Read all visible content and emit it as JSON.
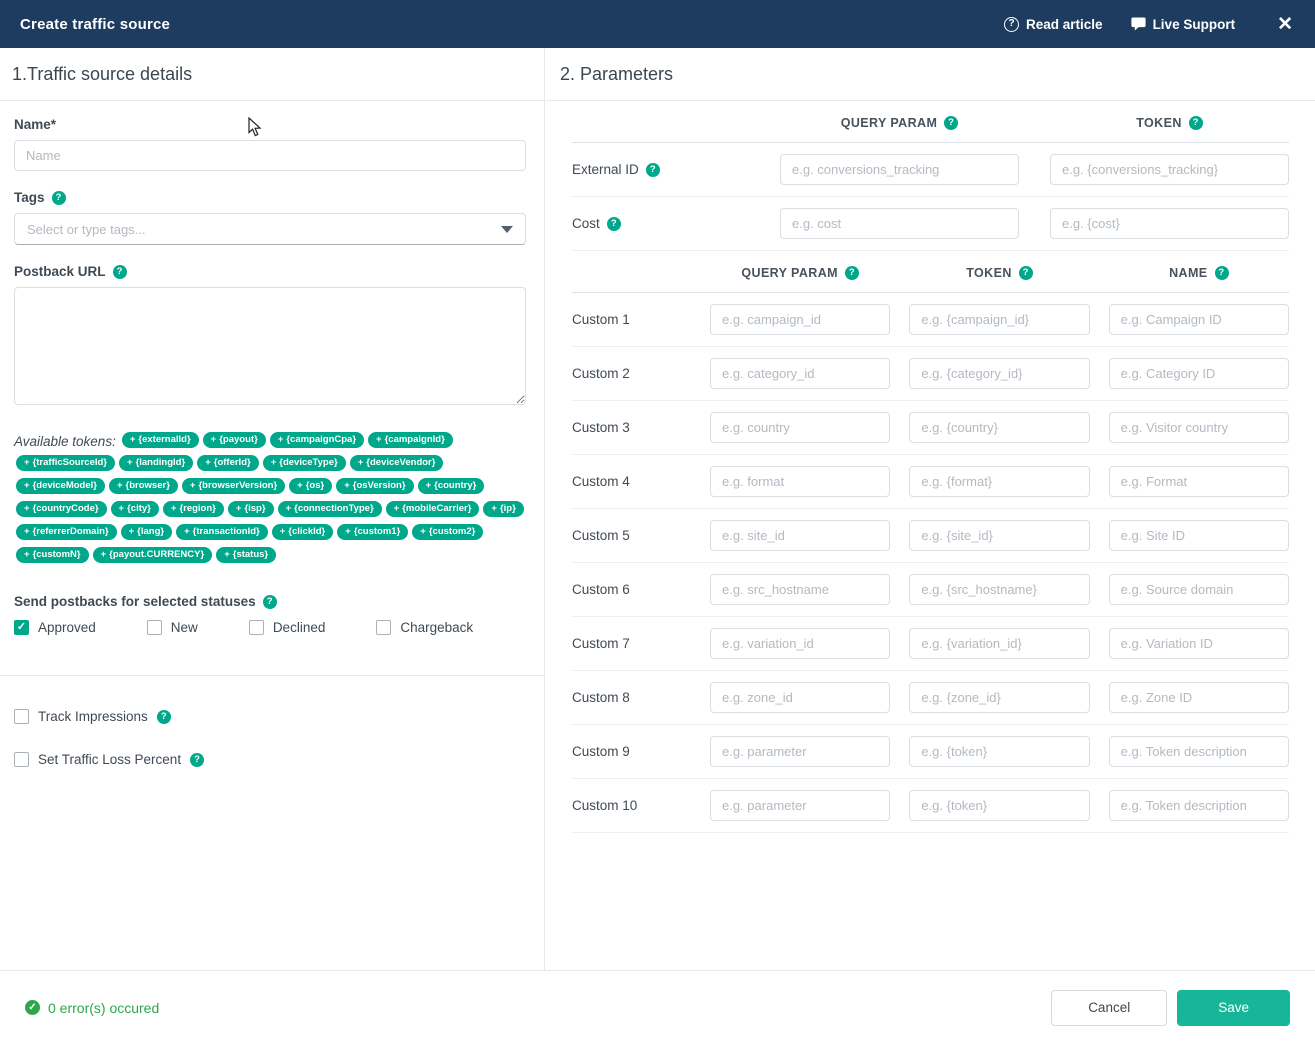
{
  "colors": {
    "header_bg": "#1e3c5f",
    "accent": "#00a88b",
    "save_bg": "#17b69a",
    "success": "#2ba84a",
    "text": "#3f4a54",
    "placeholder": "#b3bac1",
    "border": "#d9dee3"
  },
  "header": {
    "title": "Create traffic source",
    "read_article": "Read article",
    "live_support": "Live Support",
    "close_icon": "✕"
  },
  "left": {
    "section_title": "1.Traffic source details",
    "name_label": "Name*",
    "name_placeholder": "Name",
    "tags_label": "Tags",
    "tags_placeholder": "Select or type tags...",
    "postback_label": "Postback URL",
    "postback_value": "",
    "available_tokens_label": "Available tokens:",
    "tokens": [
      "{externalId}",
      "{payout}",
      "{campaignCpa}",
      "{campaignId}",
      "{trafficSourceId}",
      "{landingId}",
      "{offerId}",
      "{deviceType}",
      "{deviceVendor}",
      "{deviceModel}",
      "{browser}",
      "{browserVersion}",
      "{os}",
      "{osVersion}",
      "{country}",
      "{countryCode}",
      "{city}",
      "{region}",
      "{isp}",
      "{connectionType}",
      "{mobileCarrier}",
      "{ip}",
      "{referrerDomain}",
      "{lang}",
      "{transactionId}",
      "{clickId}",
      "{custom1}",
      "{custom2}",
      "{customN}",
      "{payout.CURRENCY}",
      "{status}"
    ],
    "statuses_label": "Send postbacks for selected statuses",
    "statuses": [
      {
        "label": "Approved",
        "checked": true
      },
      {
        "label": "New",
        "checked": false
      },
      {
        "label": "Declined",
        "checked": false
      },
      {
        "label": "Chargeback",
        "checked": false
      }
    ],
    "track_impressions_label": "Track Impressions",
    "traffic_loss_label": "Set Traffic Loss Percent"
  },
  "right": {
    "section_title": "2. Parameters",
    "top_header": {
      "query": "QUERY PARAM",
      "token": "TOKEN"
    },
    "top_rows": [
      {
        "label": "External ID",
        "query": "e.g. conversions_tracking",
        "token": "e.g. {conversions_tracking}"
      },
      {
        "label": "Cost",
        "query": "e.g. cost",
        "token": "e.g. {cost}"
      }
    ],
    "custom_header": {
      "query": "QUERY PARAM",
      "token": "TOKEN",
      "name": "NAME"
    },
    "custom_rows": [
      {
        "label": "Custom 1",
        "query": "e.g. campaign_id",
        "token": "e.g. {campaign_id}",
        "name": "e.g. Campaign ID"
      },
      {
        "label": "Custom 2",
        "query": "e.g. category_id",
        "token": "e.g. {category_id}",
        "name": "e.g. Category ID"
      },
      {
        "label": "Custom 3",
        "query": "e.g. country",
        "token": "e.g. {country}",
        "name": "e.g. Visitor country"
      },
      {
        "label": "Custom 4",
        "query": "e.g. format",
        "token": "e.g. {format}",
        "name": "e.g. Format"
      },
      {
        "label": "Custom 5",
        "query": "e.g. site_id",
        "token": "e.g. {site_id}",
        "name": "e.g. Site ID"
      },
      {
        "label": "Custom 6",
        "query": "e.g. src_hostname",
        "token": "e.g. {src_hostname}",
        "name": "e.g. Source domain"
      },
      {
        "label": "Custom 7",
        "query": "e.g. variation_id",
        "token": "e.g. {variation_id}",
        "name": "e.g. Variation ID"
      },
      {
        "label": "Custom 8",
        "query": "e.g. zone_id",
        "token": "e.g. {zone_id}",
        "name": "e.g. Zone ID"
      },
      {
        "label": "Custom 9",
        "query": "e.g. parameter",
        "token": "e.g. {token}",
        "name": "e.g. Token description"
      },
      {
        "label": "Custom 10",
        "query": "e.g. parameter",
        "token": "e.g. {token}",
        "name": "e.g. Token description"
      }
    ]
  },
  "footer": {
    "status_message": "0 error(s) occured",
    "cancel_label": "Cancel",
    "save_label": "Save"
  }
}
